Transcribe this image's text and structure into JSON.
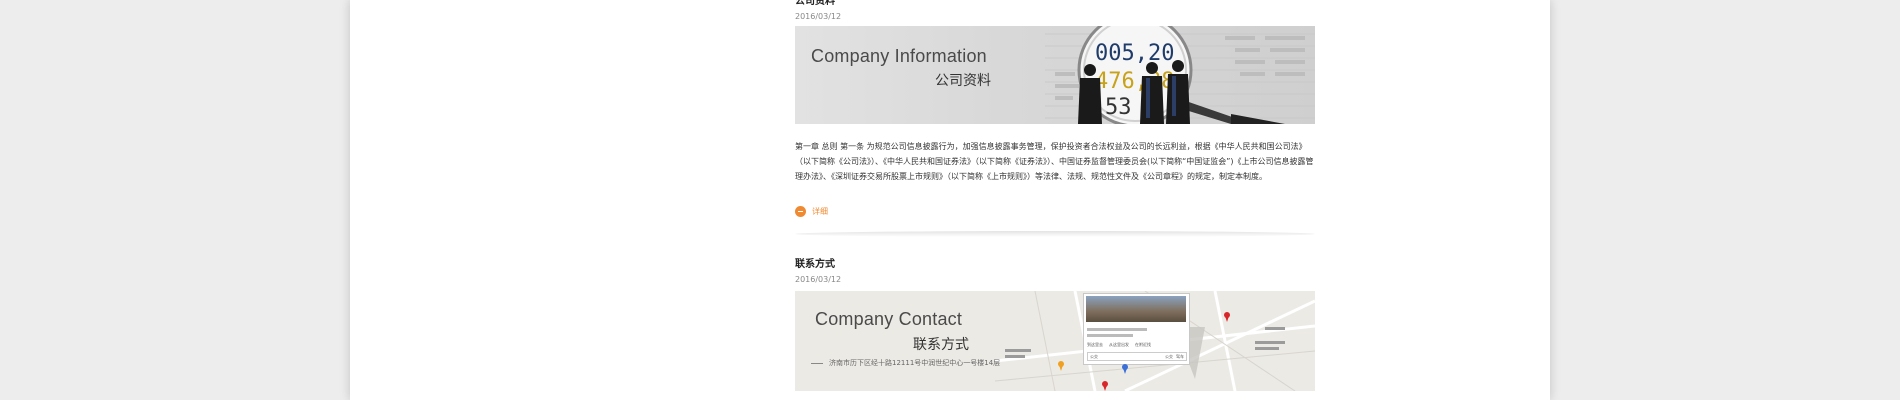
{
  "articles": [
    {
      "title": "公司资料",
      "date": "2016/03/12",
      "banner_en": "Company Information",
      "banner_zh": "公司资料",
      "summary": "第一章 总则 第一条 为规范公司信息披露行为，加强信息披露事务管理，保护投资者合法权益及公司的长远利益，根据《中华人民共和国公司法》（以下简称《公司法》）、《中华人民共和国证券法》（以下简称《证券法》）、中国证券监督管理委员会(以下简称“中国证监会”)《上市公司信息披露管理办法》、《深圳证券交易所股票上市规则》（以下简称《上市规则》）等法律、法规、规范性文件及《公司章程》的规定，制定本制度。",
      "more_label": "详细",
      "image_numbers": [
        "005,20",
        "476,38",
        "53"
      ]
    },
    {
      "title": "联系方式",
      "date": "2016/03/12",
      "banner_en": "Company Contact",
      "banner_zh": "联系方式",
      "address": "济南市历下区经十路12111号中润世纪中心一号楼14层",
      "map_popup": {
        "btn_left": "到这里去",
        "btn_mid": "从这里出发",
        "btn_right": "在附近找",
        "search_left": "公交",
        "search_btn1": "公交",
        "search_btn2": "驾车"
      }
    }
  ],
  "colors": {
    "accent": "#f08a32",
    "map_pin": "#d9262b"
  }
}
